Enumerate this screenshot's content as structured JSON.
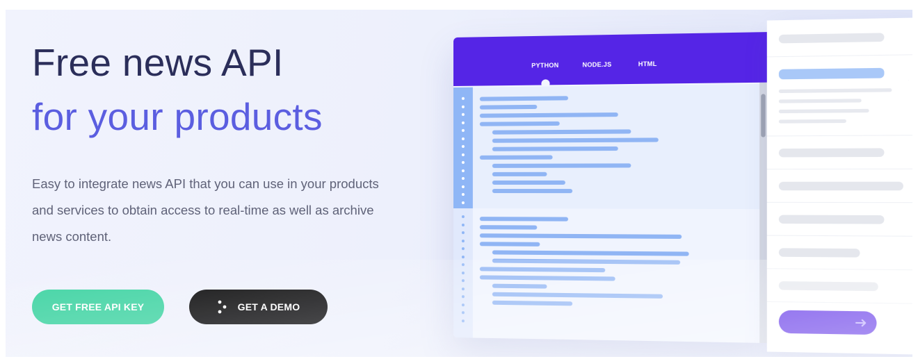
{
  "hero": {
    "title_line1": "Free news API",
    "title_line2": "for your products",
    "description": "Easy to integrate news API that you can use in your products and services to obtain access to real-time as well as archive news content.",
    "primary_button": "GET FREE API KEY",
    "secondary_button": "GET A DEMO"
  },
  "code_window": {
    "tabs": [
      "PYTHON",
      "NODE.JS",
      "HTML"
    ],
    "active_tab": "PYTHON"
  },
  "colors": {
    "title_dark": "#2b2e5a",
    "title_accent": "#5b5ee0",
    "primary_button": "#3ed3a2",
    "secondary_button": "#050507",
    "tab_bar": "#5525e6"
  },
  "icons": {
    "demo": "dots-icon",
    "side_button": "arrow-right-icon"
  }
}
